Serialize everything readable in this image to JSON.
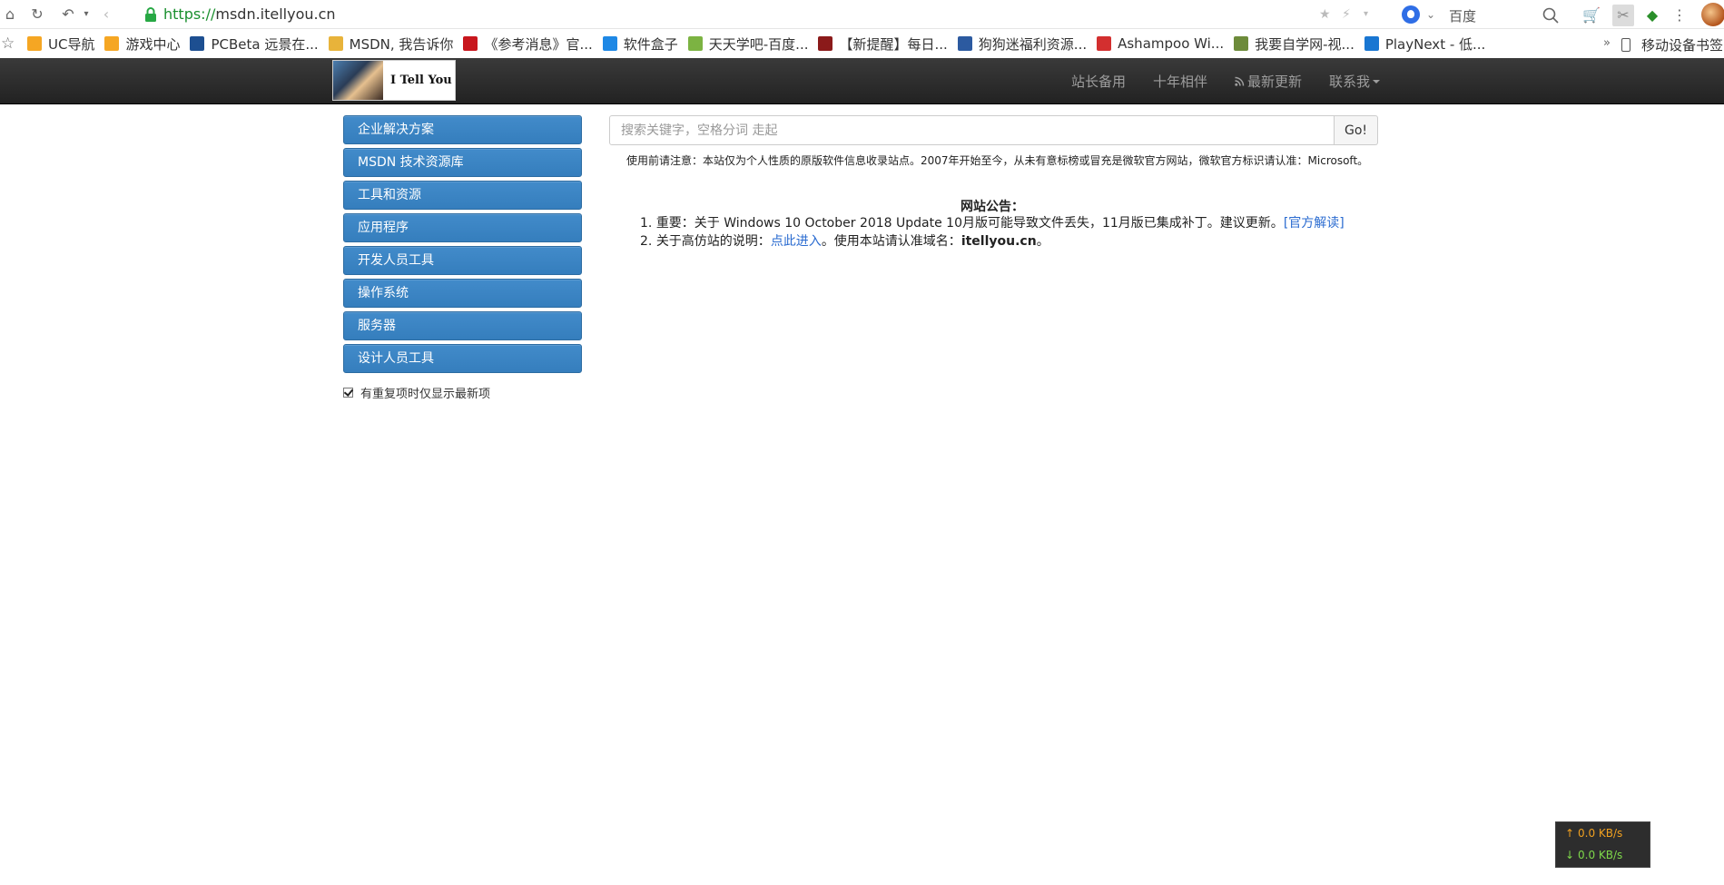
{
  "browser": {
    "url_scheme": "https://",
    "url_host": "msdn.itellyou.cn",
    "search_engine_name": "百度",
    "bookmarks": [
      {
        "label": "UC导航",
        "icon": "uc-nav-icon",
        "color": "#f5a623"
      },
      {
        "label": "游戏中心",
        "icon": "game-center-icon",
        "color": "#f5a623"
      },
      {
        "label": "PCBeta 远景在...",
        "icon": "pcbeta-icon",
        "color": "#1d4f91"
      },
      {
        "label": "MSDN, 我告诉你",
        "icon": "msdn-icon",
        "color": "#e8b33a"
      },
      {
        "label": "《参考消息》官...",
        "icon": "cankao-icon",
        "color": "#c8161d"
      },
      {
        "label": "软件盒子",
        "icon": "software-box-icon",
        "color": "#1e88e5"
      },
      {
        "label": "天天学吧-百度...",
        "icon": "tiantian-icon",
        "color": "#7cb342"
      },
      {
        "label": "【新提醒】每日...",
        "icon": "huc-icon",
        "color": "#8b1a1a"
      },
      {
        "label": "狗狗迷福利资源...",
        "icon": "gougou-icon",
        "color": "#2c5aa0"
      },
      {
        "label": "Ashampoo Wi...",
        "icon": "ashampoo-icon",
        "color": "#d32f2f"
      },
      {
        "label": "我要自学网-视...",
        "icon": "zixue-icon",
        "color": "#6d8b3a"
      },
      {
        "label": "PlayNext - 低...",
        "icon": "playnext-icon",
        "color": "#1976d2"
      }
    ],
    "bookmarks_more": "»",
    "mobile_bookmarks": "移动设备书签"
  },
  "site": {
    "brand_text": "I Tell You",
    "nav": [
      {
        "label": "站长备用"
      },
      {
        "label": "十年相伴"
      },
      {
        "label": "最新更新",
        "icon": "rss-icon"
      },
      {
        "label": "联系我",
        "icon": "caret-down-icon"
      }
    ],
    "sidebar": [
      {
        "label": "企业解决方案"
      },
      {
        "label": "MSDN 技术资源库"
      },
      {
        "label": "工具和资源"
      },
      {
        "label": "应用程序"
      },
      {
        "label": "开发人员工具"
      },
      {
        "label": "操作系统"
      },
      {
        "label": "服务器"
      },
      {
        "label": "设计人员工具"
      }
    ],
    "dedupe_checkbox_label": "有重复项时仅显示最新项",
    "dedupe_checked": true,
    "search_placeholder": "搜索关键字，空格分词 走起",
    "search_button": "Go!",
    "notice": "使用前请注意：本站仅为个人性质的原版软件信息收录站点。2007年开始至今，从未有意标榜或冒充是微软官方网站，微软官方标识请认准：Microsoft。",
    "announce_title": "网站公告：",
    "announce_1_num": "1.",
    "announce_1_text": "重要：关于 Windows 10 October 2018 Update 10月版可能导致文件丢失，11月版已集成补丁。建议更新。",
    "announce_1_link": "[官方解读]",
    "announce_2_num": "2.",
    "announce_2_text_a": "关于高仿站的说明：",
    "announce_2_link": "点此进入",
    "announce_2_text_b": "。使用本站请认准域名：",
    "announce_2_domain": "itellyou.cn",
    "announce_2_text_c": "。"
  },
  "speed_widget": {
    "up": "0.0 KB/s",
    "down": "0.0 KB/s",
    "up_color": "#f0a020",
    "down_color": "#7ed84a"
  }
}
